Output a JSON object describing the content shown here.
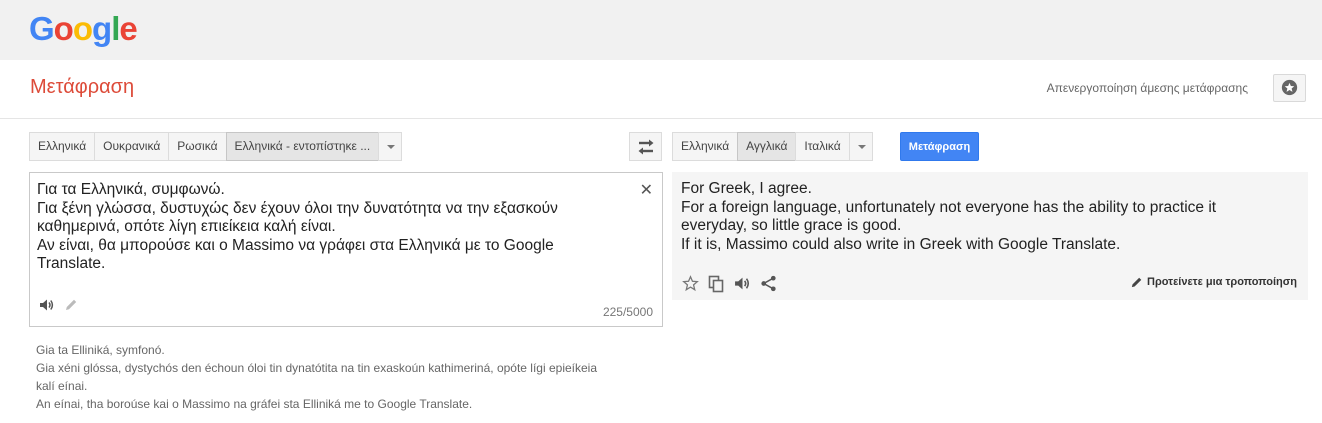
{
  "brand": {
    "logo_letters": [
      "G",
      "o",
      "o",
      "g",
      "l",
      "e"
    ],
    "logo_colors": [
      "#4285f4",
      "#ea4335",
      "#fbbc05",
      "#4285f4",
      "#34a853",
      "#ea4335"
    ]
  },
  "header": {
    "title": "Μετάφραση",
    "instant_toggle": "Απενεργοποίηση άμεσης μετάφρασης",
    "star_icon": "star-circle-icon"
  },
  "source_langs": [
    "Ελληνικά",
    "Ουκρανικά",
    "Ρωσικά",
    "Ελληνικά - εντοπίστηκε ..."
  ],
  "source_selected": 3,
  "target_langs": [
    "Ελληνικά",
    "Αγγλικά",
    "Ιταλικά"
  ],
  "target_selected": 1,
  "swap_icon": "swap-arrows-icon",
  "translate_button": "Μετάφραση",
  "source": {
    "text": "Για τα Ελληνικά, συμφωνώ.\nΓια ξένη γλώσσα, δυστυχώς δεν έχουν όλοι την δυνατότητα να την εξασκούν\nκαθημερινά, οπότε λίγη επιείκεια καλή είναι.\nΑν είναι, θα μπορούσε και ο Massimo να γράφει στα Ελληνικά με το Google\nTranslate.",
    "char_count": "225/5000"
  },
  "target": {
    "text": "For Greek, I agree.\nFor a foreign language, unfortunately not everyone has the ability to practice it\neveryday, so little grace is good.\nIf it is, Massimo could also write in Greek with Google Translate.",
    "suggest_edit": "Προτείνετε μια τροποποίηση"
  },
  "transliteration": [
    "Gia ta Elliniká, symfonó.",
    "Gia xéni glóssa, dystychós den échoun óloi tin dynatótita na tin exaskoún kathimeriná, opóte lígi epieíkeia",
    "kalí eínai.",
    "An eínai, tha boroúse kai o Massimo na gráfei sta Elliniká me to Google Translate."
  ]
}
